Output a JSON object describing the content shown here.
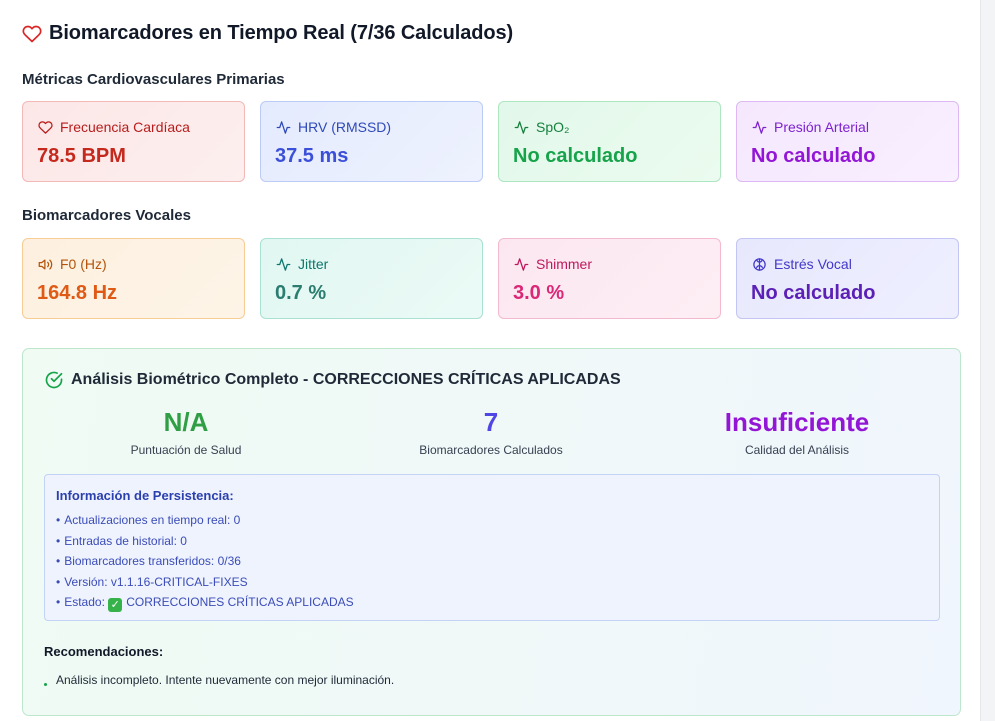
{
  "header": {
    "title": "Biomarcadores en Tiempo Real (7/36 Calculados)",
    "icon": "heart-icon"
  },
  "cardio": {
    "section_label": "Métricas Cardiovasculares Primarias",
    "cards": [
      {
        "label": "Frecuencia Cardíaca",
        "value": "78.5 BPM",
        "icon": "heart-icon"
      },
      {
        "label": "HRV (RMSSD)",
        "value": "37.5 ms",
        "icon": "activity-icon"
      },
      {
        "label": "SpO₂",
        "value": "No calculado",
        "icon": "activity-icon"
      },
      {
        "label": "Presión Arterial",
        "value": "No calculado",
        "icon": "activity-icon"
      }
    ]
  },
  "vocal": {
    "section_label": "Biomarcadores Vocales",
    "cards": [
      {
        "label": "F0 (Hz)",
        "value": "164.8 Hz",
        "icon": "speaker-icon"
      },
      {
        "label": "Jitter",
        "value": "0.7 %",
        "icon": "activity-icon"
      },
      {
        "label": "Shimmer",
        "value": "3.0 %",
        "icon": "activity-icon"
      },
      {
        "label": "Estrés Vocal",
        "value": "No calculado",
        "icon": "brain-icon"
      }
    ]
  },
  "analysis": {
    "title": "Análisis Biométrico Completo - CORRECCIONES CRÍTICAS APLICADAS",
    "stats": [
      {
        "value": "N/A",
        "label": "Puntuación de Salud",
        "color": "#2f9e44"
      },
      {
        "value": "7",
        "label": "Biomarcadores Calculados",
        "color": "#4f46e5"
      },
      {
        "value": "Insuficiente",
        "label": "Calidad del Análisis",
        "color": "#9316d6"
      }
    ],
    "persistence": {
      "heading": "Información de Persistencia:",
      "items": [
        "Actualizaciones en tiempo real: 0",
        "Entradas de historial: 0",
        "Biomarcadores transferidos: 0/36",
        "Versión: v1.1.16-CRITICAL-FIXES"
      ],
      "status_prefix": "Estado:",
      "status_text": "CORRECCIONES CRÍTICAS APLICADAS"
    },
    "recommendations": {
      "heading": "Recomendaciones:",
      "items": [
        "Análisis incompleto. Intente nuevamente con mejor iluminación."
      ]
    }
  }
}
